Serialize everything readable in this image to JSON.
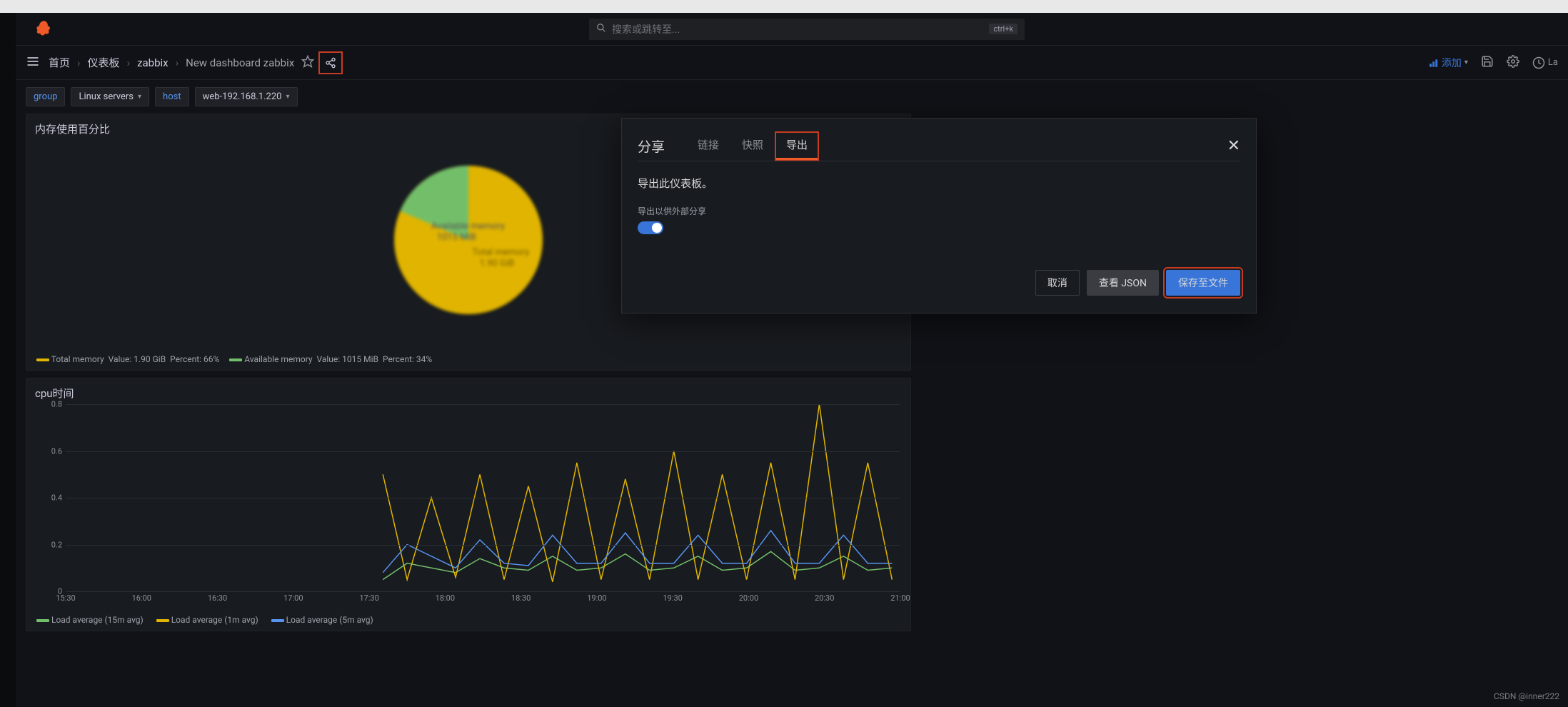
{
  "topbar": {
    "search_placeholder": "搜索或跳转至...",
    "kbd_hint": "ctrl+k"
  },
  "nav": {
    "home": "首页",
    "dashboards": "仪表板",
    "folder": "zabbix",
    "current": "New dashboard zabbix",
    "add_label": "添加",
    "last_label": "La"
  },
  "vars": {
    "group_label": "group",
    "group_value": "Linux servers",
    "host_label": "host",
    "host_value": "web-192.168.1.220"
  },
  "pie_panel": {
    "title": "内存使用百分比",
    "legend": [
      {
        "name": "Total memory",
        "value_label": "Value:",
        "value": "1.90 GiB",
        "percent_label": "Percent:",
        "percent": "66%",
        "color": "#e0b400"
      },
      {
        "name": "Available memory",
        "value_label": "Value:",
        "value": "1015 MiB",
        "percent_label": "Percent:",
        "percent": "34%",
        "color": "#73bf69"
      }
    ],
    "slice_labels": {
      "avail_name": "Available memory",
      "avail_val": "1015 MiB",
      "total_name": "Total memory",
      "total_val": "1.90 GiB"
    }
  },
  "line_panel": {
    "title": "cpu时间",
    "legend": [
      {
        "name": "Load average (15m avg)",
        "color": "#73bf69"
      },
      {
        "name": "Load average (1m avg)",
        "color": "#e0b400"
      },
      {
        "name": "Load average (5m avg)",
        "color": "#5794f2"
      }
    ]
  },
  "chart_data": [
    {
      "type": "pie",
      "title": "内存使用百分比",
      "series": [
        {
          "name": "Total memory",
          "value": 1.9,
          "unit": "GiB",
          "percent": 66,
          "color": "#e0b400"
        },
        {
          "name": "Available memory",
          "value": 1015,
          "unit": "MiB",
          "percent": 34,
          "color": "#73bf69"
        }
      ]
    },
    {
      "type": "line",
      "title": "cpu时间",
      "ylabel": "",
      "ylim": [
        0,
        0.8
      ],
      "y_ticks": [
        0,
        0.2,
        0.4,
        0.6,
        0.8
      ],
      "x_ticks": [
        "15:30",
        "16:00",
        "16:30",
        "17:00",
        "17:30",
        "18:00",
        "18:30",
        "19:00",
        "19:30",
        "20:00",
        "20:30",
        "21:00"
      ],
      "series": [
        {
          "name": "Load average (15m avg)",
          "color": "#73bf69",
          "x": [
            "17:40",
            "17:50",
            "18:00",
            "18:10",
            "18:20",
            "18:30",
            "18:40",
            "18:50",
            "19:00",
            "19:10",
            "19:20",
            "19:30",
            "19:40",
            "19:50",
            "20:00",
            "20:10",
            "20:20",
            "20:30",
            "20:40",
            "20:50",
            "21:00",
            "21:10"
          ],
          "values": [
            0.05,
            0.12,
            0.1,
            0.08,
            0.14,
            0.1,
            0.09,
            0.15,
            0.09,
            0.1,
            0.16,
            0.09,
            0.1,
            0.15,
            0.09,
            0.1,
            0.17,
            0.09,
            0.1,
            0.15,
            0.09,
            0.1
          ]
        },
        {
          "name": "Load average (1m avg)",
          "color": "#e0b400",
          "x": [
            "17:40",
            "17:50",
            "18:00",
            "18:10",
            "18:20",
            "18:30",
            "18:40",
            "18:50",
            "19:00",
            "19:10",
            "19:20",
            "19:30",
            "19:40",
            "19:50",
            "20:00",
            "20:10",
            "20:20",
            "20:30",
            "20:40",
            "20:50",
            "21:00",
            "21:10"
          ],
          "values": [
            0.5,
            0.05,
            0.4,
            0.06,
            0.5,
            0.05,
            0.45,
            0.04,
            0.55,
            0.05,
            0.48,
            0.05,
            0.6,
            0.05,
            0.5,
            0.05,
            0.55,
            0.05,
            0.8,
            0.05,
            0.55,
            0.05
          ]
        },
        {
          "name": "Load average (5m avg)",
          "color": "#5794f2",
          "x": [
            "17:40",
            "17:50",
            "18:00",
            "18:10",
            "18:20",
            "18:30",
            "18:40",
            "18:50",
            "19:00",
            "19:10",
            "19:20",
            "19:30",
            "19:40",
            "19:50",
            "20:00",
            "20:10",
            "20:20",
            "20:30",
            "20:40",
            "20:50",
            "21:00",
            "21:10"
          ],
          "values": [
            0.08,
            0.2,
            0.15,
            0.1,
            0.22,
            0.12,
            0.11,
            0.24,
            0.12,
            0.12,
            0.25,
            0.12,
            0.12,
            0.24,
            0.12,
            0.12,
            0.26,
            0.12,
            0.12,
            0.24,
            0.12,
            0.12
          ]
        }
      ]
    }
  ],
  "modal": {
    "title": "分享",
    "tabs": {
      "link": "链接",
      "snapshot": "快照",
      "export": "导出"
    },
    "desc": "导出此仪表板。",
    "toggle_label": "导出以供外部分享",
    "buttons": {
      "cancel": "取消",
      "view_json": "查看 JSON",
      "save_file": "保存至文件"
    }
  },
  "watermark": "CSDN @inner222"
}
